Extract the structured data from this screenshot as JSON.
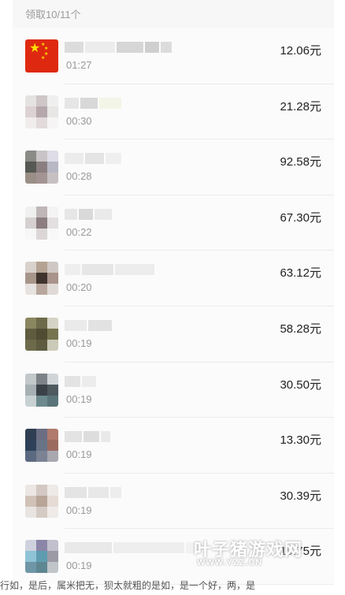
{
  "header": {
    "claimed_label": "领取10/11个"
  },
  "entries": [
    {
      "time": "01:27",
      "amount": "12.06元"
    },
    {
      "time": "00:30",
      "amount": "21.28元"
    },
    {
      "time": "00:28",
      "amount": "92.58元"
    },
    {
      "time": "00:22",
      "amount": "67.30元"
    },
    {
      "time": "00:20",
      "amount": "63.12元"
    },
    {
      "time": "00:19",
      "amount": "58.28元"
    },
    {
      "time": "00:19",
      "amount": "30.50元"
    },
    {
      "time": "00:19",
      "amount": "13.30元"
    },
    {
      "time": "00:19",
      "amount": "30.39元"
    },
    {
      "time": "00:19",
      "amount": "19.75元"
    }
  ],
  "watermark": {
    "main": "叶子猪游戏网",
    "sub": "WWW.YZZ.CN"
  },
  "caption": "行如，是后，属米把无，狈太就粗的是如，是一个好，两，是"
}
